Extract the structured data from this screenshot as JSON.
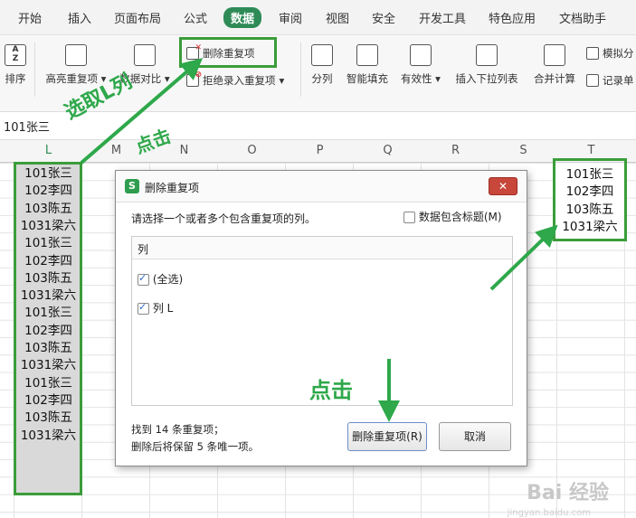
{
  "menu": {
    "items": [
      "开始",
      "插入",
      "页面布局",
      "公式",
      "数据",
      "审阅",
      "视图",
      "安全",
      "开发工具",
      "特色应用",
      "文档助手"
    ],
    "active_index": 4
  },
  "ribbon": {
    "sort_label": "排序",
    "highlight_dup_label": "高亮重复项",
    "data_compare_label": "数据对比",
    "remove_dup_label": "删除重复项",
    "reject_dup_label": "拒绝录入重复项",
    "split_label": "分列",
    "smart_fill_label": "智能填充",
    "validity_label": "有效性",
    "insert_dropdown_label": "插入下拉列表",
    "merge_calc_label": "合并计算",
    "simulate_label": "模拟分",
    "record_label": "记录单"
  },
  "formula_bar": {
    "value": "101张三"
  },
  "columns": [
    "L",
    "M",
    "N",
    "O",
    "P",
    "Q",
    "R",
    "S",
    "T"
  ],
  "column_l_values": [
    "101张三",
    "102李四",
    "103陈五",
    "1031梁六",
    "101张三",
    "102李四",
    "103陈五",
    "1031梁六",
    "101张三",
    "102李四",
    "103陈五",
    "1031梁六",
    "101张三",
    "102李四",
    "103陈五",
    "1031梁六"
  ],
  "column_t_values": [
    "101张三",
    "102李四",
    "103陈五",
    "1031梁六"
  ],
  "dialog": {
    "title": "删除重复项",
    "close_label": "✕",
    "prompt": "请选择一个或者多个包含重复项的列。",
    "header_checkbox_label": "数据包含标题(M)",
    "list_header": "列",
    "select_all_label": "(全选)",
    "column_item_label": "列 L",
    "result_line1": "找到 14 条重复项；",
    "result_line2": "删除后将保留 5 条唯一项。",
    "confirm_label": "删除重复项(R)",
    "cancel_label": "取消"
  },
  "annotations": {
    "select_column": "选取L列",
    "click_top": "点击",
    "click_bottom": "点击"
  },
  "watermark": {
    "main": "Bai 经验",
    "sub": "jingyan.baidu.com"
  },
  "colors": {
    "accent_green": "#2e8b57",
    "annotation_green": "#3a9d3a",
    "close_red": "#c8463a"
  }
}
